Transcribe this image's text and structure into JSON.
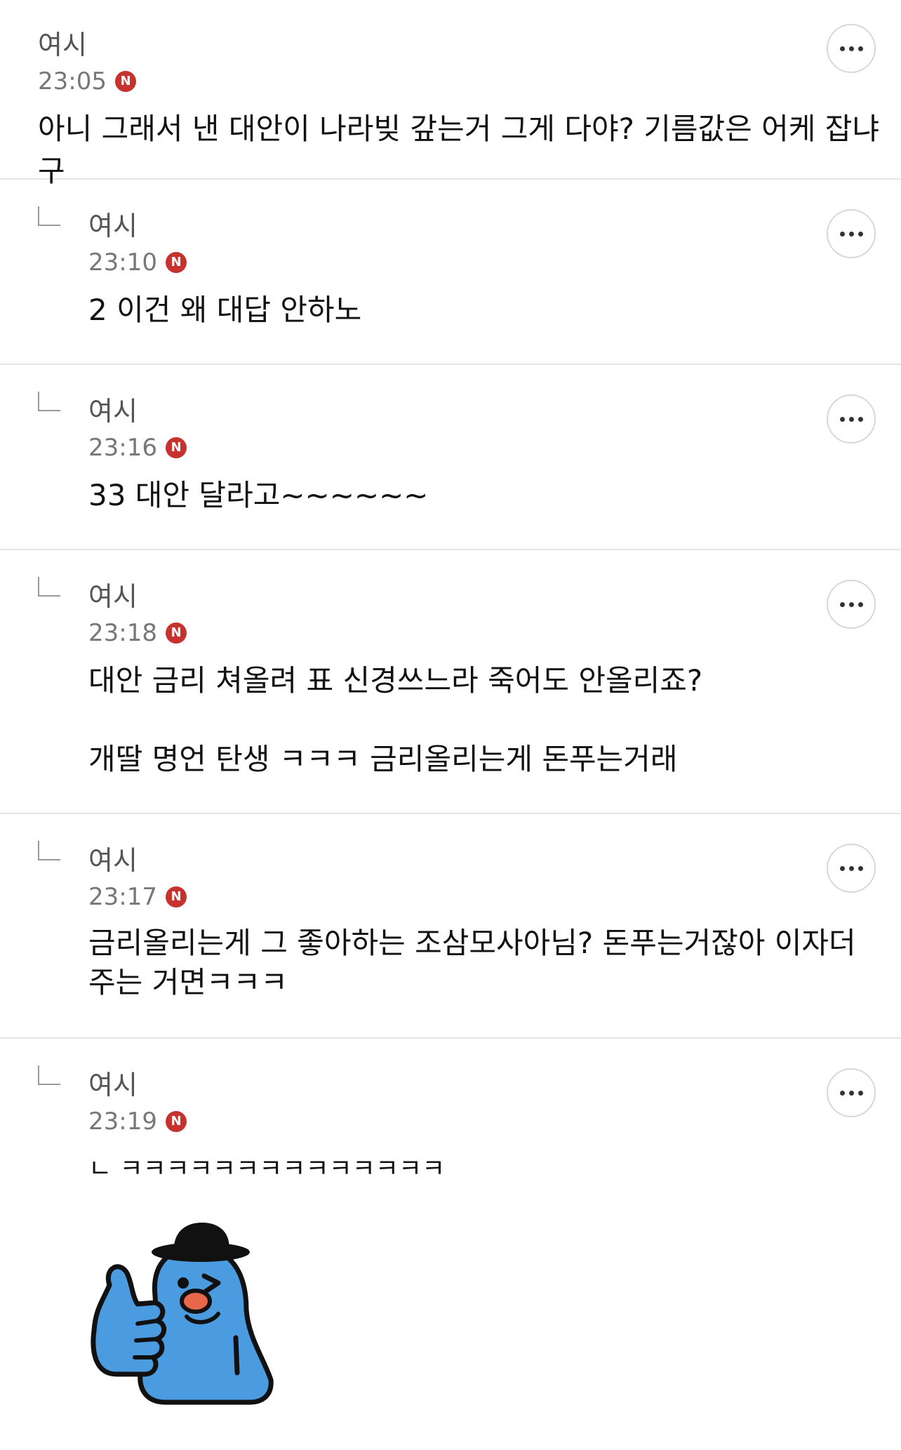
{
  "comments": [
    {
      "author": "여시",
      "time": "23:05",
      "badge": "N",
      "text": "아니 그래서 낸 대안이 나라빚 갚는거 그게 다야? 기름값은 어케 잡냐구"
    },
    {
      "author": "여시",
      "time": "23:10",
      "badge": "N",
      "text": "2 이건 왜 대답 안하노"
    },
    {
      "author": "여시",
      "time": "23:16",
      "badge": "N",
      "text": "33 대안 달라고~~~~~~"
    },
    {
      "author": "여시",
      "time": "23:18",
      "badge": "N",
      "text": "대안 금리 쳐올려 표 신경쓰느라 죽어도 안올리죠?",
      "text2": "개딸 명언 탄생 ㅋㅋㅋ 금리올리는게 돈푸는거래"
    },
    {
      "author": "여시",
      "time": "23:17",
      "badge": "N",
      "text": "금리올리는게 그 좋아하는 조삼모사아님? 돈푸는거잖아 이자더주는 거면ㅋㅋㅋ"
    },
    {
      "author": "여시",
      "time": "23:19",
      "badge": "N",
      "text": "ㄴ ㅋㅋㅋㅋㅋㅋㅋㅋㅋㅋㅋㅋㅋㅋ",
      "sticker": "thumbs-up-blue-character-sticker"
    }
  ],
  "icons": {
    "more": "more-options-icon",
    "reply": "reply-arrow-icon"
  },
  "colors": {
    "badge": "#c6322e",
    "sticker_blue": "#4a9be0",
    "divider": "#e6e6e6"
  }
}
